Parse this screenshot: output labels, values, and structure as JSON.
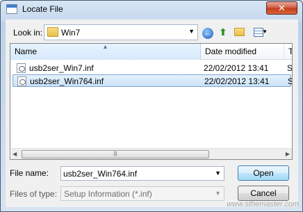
{
  "window": {
    "title": "Locate File",
    "close_label": "✕"
  },
  "toolbar": {
    "look_in_label": "Look in:",
    "look_in_value": "Win7",
    "back_icon": "back-arrow-icon",
    "up_icon": "up-folder-icon",
    "new_folder_icon": "new-folder-icon",
    "views_icon": "views-menu-icon"
  },
  "list": {
    "columns": [
      "Name",
      "Date modified",
      "Ty"
    ],
    "rows": [
      {
        "name": "usb2ser_Win7.inf",
        "date": "22/02/2012 13:41",
        "type": "Se"
      },
      {
        "name": "usb2ser_Win764.inf",
        "date": "22/02/2012 13:41",
        "type": "Se"
      }
    ],
    "selected_index": 1,
    "scroll_grip": "|||"
  },
  "footer": {
    "file_name_label": "File name:",
    "file_name_value": "usb2ser_Win764.inf",
    "file_type_label": "Files of type:",
    "file_type_value": "Setup Information (*.inf)",
    "open_label": "Open",
    "cancel_label": "Cancel"
  },
  "watermark": "www.sthemaster.com",
  "colors": {
    "accent": "#3c7fb1",
    "selection": "#cbe3f8",
    "close": "#c33b1c"
  }
}
